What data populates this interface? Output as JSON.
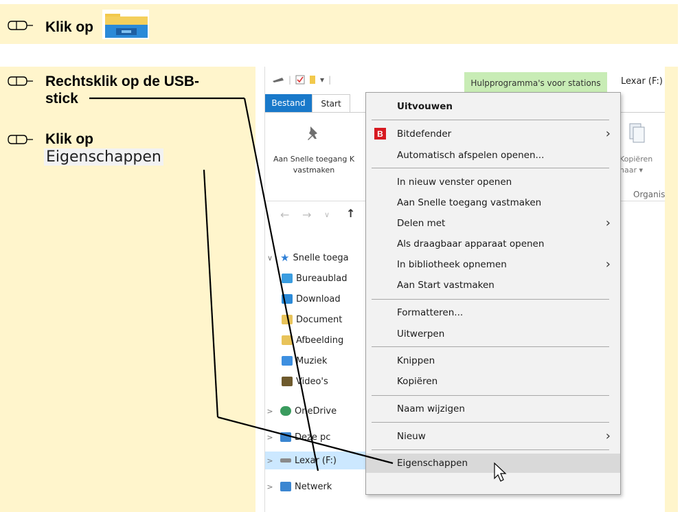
{
  "instructions": {
    "step1": "Klik op",
    "step2_line1": "Rechtsklik op de USB-",
    "step2_line2": "stick",
    "step3": "Klik op",
    "step3_label": "Eigenschappen"
  },
  "window": {
    "contextual_tab": "Hulpprogramma's voor stations",
    "title": "Lexar (F:)",
    "tabs": [
      "Bestand",
      "Start"
    ],
    "ribbon": {
      "pin_line1": "Aan Snelle toegang",
      "pin_line2": "vastmaken",
      "pin_cut": "K",
      "copy_line1": "Kopiëren",
      "copy_line2": "naar",
      "group": "Organis"
    },
    "nav": [
      "←",
      "→",
      "∨",
      "↑"
    ],
    "tree": [
      {
        "label": "Snelle toega",
        "icon": "star-icon",
        "color": "#2f7fd6"
      },
      {
        "label": "Bureaublad",
        "icon": "desktop-folder-icon",
        "color": "#3b9de0"
      },
      {
        "label": "Download",
        "icon": "downloads-folder-icon",
        "color": "#2b8ad8"
      },
      {
        "label": "Document",
        "icon": "documents-folder-icon",
        "color": "#e8c35a"
      },
      {
        "label": "Afbeelding",
        "icon": "pictures-folder-icon",
        "color": "#e8c35a"
      },
      {
        "label": "Muziek",
        "icon": "music-folder-icon",
        "color": "#3d8fe0"
      },
      {
        "label": "Video's",
        "icon": "videos-folder-icon",
        "color": "#6e5a2d"
      },
      {
        "label": "OneDrive",
        "icon": "onedrive-icon",
        "color": "#3a9b5e"
      },
      {
        "label": "Deze pc",
        "icon": "this-pc-icon",
        "color": "#3b86d1"
      },
      {
        "label": "Lexar (F:)",
        "icon": "usb-drive-icon",
        "color": "#8a8a8a"
      },
      {
        "label": "Netwerk",
        "icon": "network-icon",
        "color": "#3b86d1"
      }
    ]
  },
  "context_menu": {
    "uitvouwen": "Uitvouwen",
    "bitdefender": "Bitdefender",
    "bitdefender_icon_letter": "B",
    "autoplay": "Automatisch afspelen openen...",
    "new_window": "In nieuw venster openen",
    "pin_quick": "Aan Snelle toegang vastmaken",
    "share": "Delen met",
    "portable": "Als draagbaar apparaat openen",
    "library": "In bibliotheek opnemen",
    "pin_start": "Aan Start vastmaken",
    "format": "Formatteren...",
    "eject": "Uitwerpen",
    "cut": "Knippen",
    "copy": "Kopiëren",
    "rename": "Naam wijzigen",
    "new": "Nieuw",
    "properties": "Eigenschappen",
    "submenu_arrow": "›"
  },
  "colors": {
    "band": "#fff5cc",
    "bestand_tab": "#1979ca",
    "contextual_tab": "#c8ecb5",
    "selection": "#cce8ff",
    "bitdefender": "#d71920"
  }
}
